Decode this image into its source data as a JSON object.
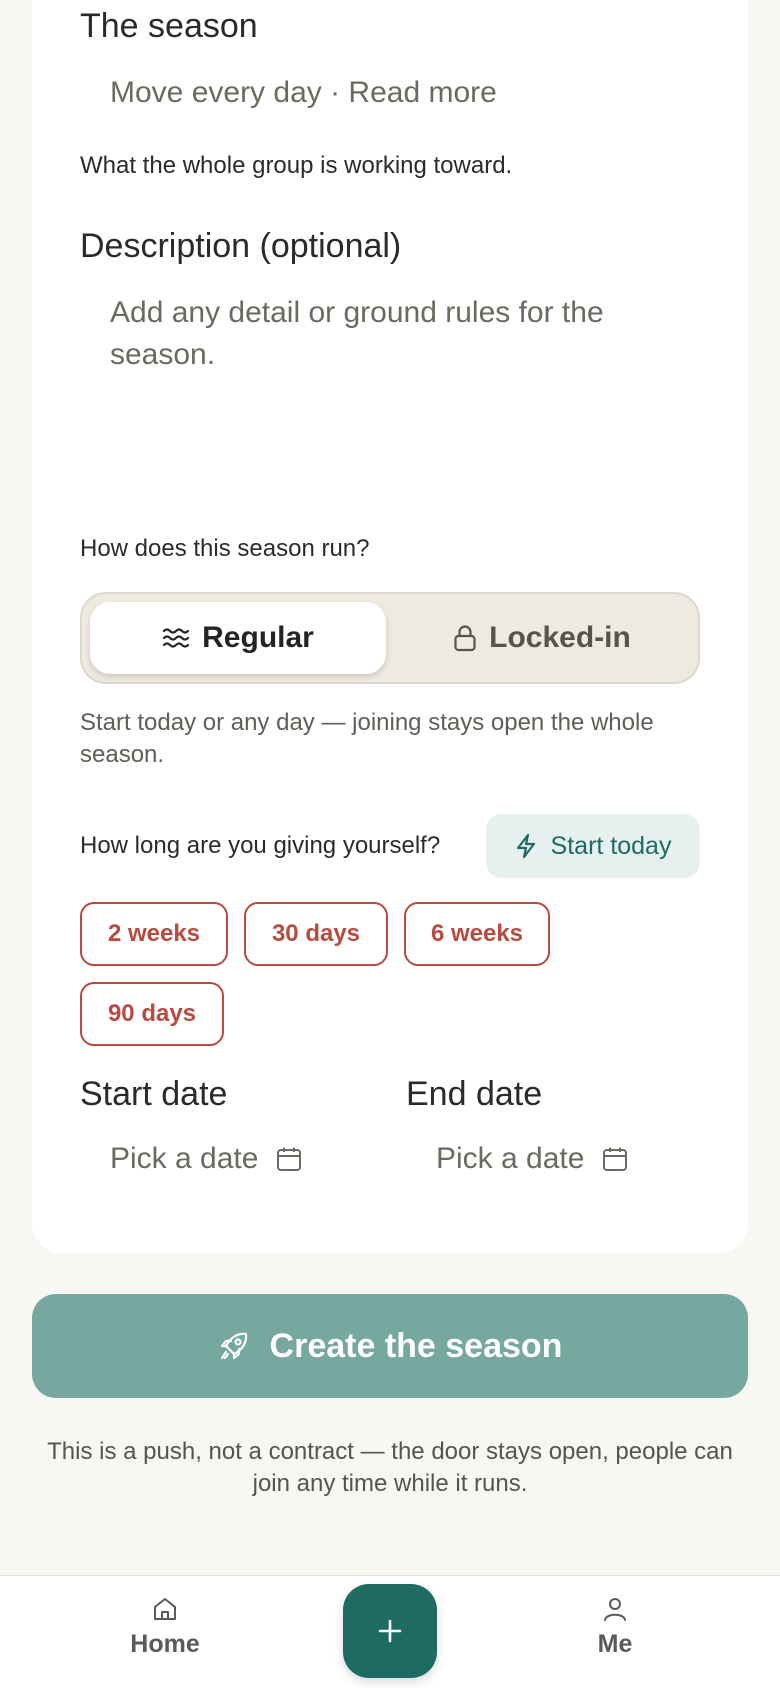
{
  "season_field": {
    "title": "The season",
    "value": "Move every day · Read more",
    "helper": "What the whole group is working toward."
  },
  "description_field": {
    "title": "Description (optional)",
    "placeholder": "Add any detail or ground rules for the season."
  },
  "run_mode": {
    "question": "How does this season run?",
    "options": [
      {
        "label": "Regular",
        "icon": "waves-icon",
        "selected": true
      },
      {
        "label": "Locked-in",
        "icon": "lock-icon",
        "selected": false
      }
    ],
    "helper": "Start today or any day — joining stays open the whole season."
  },
  "duration": {
    "question": "How long are you giving yourself?",
    "start_today_label": "Start today",
    "chips": [
      "2 weeks",
      "30 days",
      "6 weeks",
      "90 days"
    ]
  },
  "dates": {
    "start_label": "Start date",
    "start_placeholder": "Pick a date",
    "end_label": "End date",
    "end_placeholder": "Pick a date"
  },
  "create_button_label": "Create the season",
  "footnote": "This is a push, not a contract — the door stays open, people can join any time while it runs.",
  "bottom_nav": {
    "home_label": "Home",
    "me_label": "Me"
  },
  "colors": {
    "accent": "#1e6b64",
    "accent_muted": "#77a8a0",
    "chip_red": "#b84a3f",
    "background": "#f8f7f3"
  }
}
